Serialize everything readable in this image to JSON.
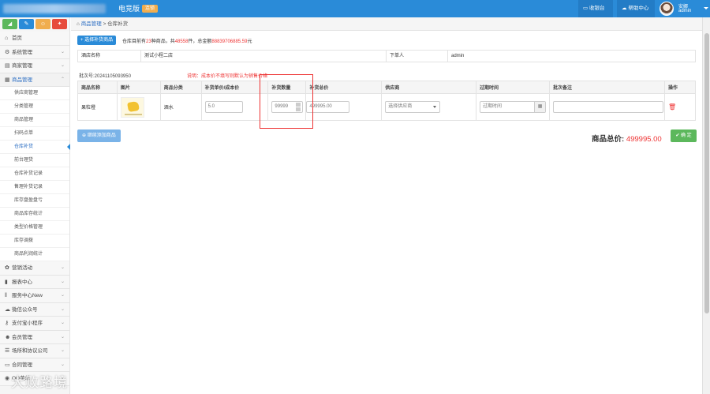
{
  "header": {
    "edition": "电竞版",
    "badge": "连锁",
    "cash_register": "收银台",
    "help_center": "帮助中心",
    "user_name": "安娜",
    "user_role": "admin",
    "brand_color": "#2a8bd8"
  },
  "sidebar": {
    "quick_buttons": [
      {
        "icon": "chart-icon",
        "glyph": "◢",
        "color": "#5cb85c"
      },
      {
        "icon": "pencil-icon",
        "glyph": "✎",
        "color": "#2a8bd8"
      },
      {
        "icon": "users-icon",
        "glyph": "☺",
        "color": "#f0ad4e"
      },
      {
        "icon": "cogs-icon",
        "glyph": "✦",
        "color": "#e74c3c"
      }
    ],
    "top_items": [
      {
        "label": "首页",
        "icon": "home-icon",
        "glyph": "⌂"
      },
      {
        "label": "系统管理",
        "icon": "gear-icon",
        "glyph": "⚙"
      },
      {
        "label": "商家管理",
        "icon": "store-icon",
        "glyph": "▤"
      },
      {
        "label": "商品管理",
        "icon": "stack-icon",
        "glyph": "▦"
      }
    ],
    "sub_items": [
      "供应商管理",
      "分类管理",
      "商品管理",
      "扫码点单",
      "仓库补货",
      "前台理货",
      "仓库补货记录",
      "售理补货记录",
      "库存盘盈盘亏",
      "商品库存统计",
      "类型价格管理",
      "库存调拨",
      "商品利润统计"
    ],
    "active_sub": 4,
    "bottom_items": [
      {
        "label": "营销活动",
        "icon": "gift-icon",
        "glyph": "✿"
      },
      {
        "label": "报表中心",
        "icon": "bar-chart-icon",
        "glyph": "▮"
      },
      {
        "label": "服务中心New",
        "icon": "cutlery-icon",
        "glyph": "ǁ"
      },
      {
        "label": "微信公众号",
        "icon": "cloud-icon",
        "glyph": "☁"
      },
      {
        "label": "支付宝小程序",
        "icon": "key-icon",
        "glyph": "⚷"
      },
      {
        "label": "会员管理",
        "icon": "group-icon",
        "glyph": "☻"
      },
      {
        "label": "场所和协议公司",
        "icon": "list-icon",
        "glyph": "☰"
      },
      {
        "label": "合同管理",
        "icon": "file-icon",
        "glyph": "▭"
      },
      {
        "label": "QQ菜单",
        "icon": "qq-icon",
        "glyph": "◉"
      }
    ]
  },
  "breadcrumb": {
    "parent": "商品管理",
    "separator": ">",
    "current": "仓库补货"
  },
  "toolbar": {
    "select_label": "+ 选择补货商品"
  },
  "summary": {
    "prefix": "仓库目前有",
    "kinds": "23",
    "kinds_unit": "种商品，共",
    "count": "48558",
    "count_unit": "件，总金额",
    "amount": "88839706885.59",
    "amount_unit": "元"
  },
  "info": {
    "store_label": "酒店名称",
    "store_value": "测试小程二店",
    "buyer_label": "下单人",
    "buyer_value": "admin"
  },
  "batch_label": "批次号:20241105093950",
  "hint": "说明：成本价不填写则默认为销售价格",
  "table": {
    "headers": [
      "商品名称",
      "图片",
      "商品分类",
      "补货单价/成本价",
      "补货数量",
      "补货总价",
      "供应商",
      "过期时间",
      "批次备注",
      "操作"
    ],
    "row": {
      "name": "果粒橙",
      "category": "酒水",
      "unit_price": "5.0",
      "quantity": "99999",
      "total_price": "499995.00",
      "supplier_placeholder": "选择供应商",
      "expire_placeholder": "过期时间",
      "remark": ""
    }
  },
  "add_button": "继续添加商品",
  "total": {
    "label": "商品总价:",
    "amount": "499995.00"
  },
  "confirm_button": "✔ 确 定",
  "watermark": "大败路境"
}
